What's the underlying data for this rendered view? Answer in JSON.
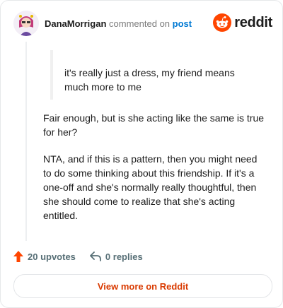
{
  "header": {
    "username": "DanaMorrigan",
    "action_text": "commented on",
    "post_link": "post",
    "brand": "reddit"
  },
  "comment": {
    "quote": "it's really just a dress, my friend means much more to me",
    "paragraphs": [
      "Fair enough, but is she acting like the same is true for her?",
      "NTA, and if this is a pattern, then you might need to do some thinking about this friendship. If it's a one-off and she's normally really thoughtful, then she should come to realize that she's acting entitled."
    ]
  },
  "footer": {
    "upvotes_label": "20 upvotes",
    "replies_label": "0 replies",
    "view_more": "View more on Reddit"
  },
  "colors": {
    "brand_orange": "#ff4500",
    "link_blue": "#0079d3",
    "cta_text": "#d93a00"
  },
  "icons": {
    "upvote": "upvote-arrow-icon",
    "reply": "reply-arrow-icon",
    "brand": "reddit-snoo-icon"
  }
}
